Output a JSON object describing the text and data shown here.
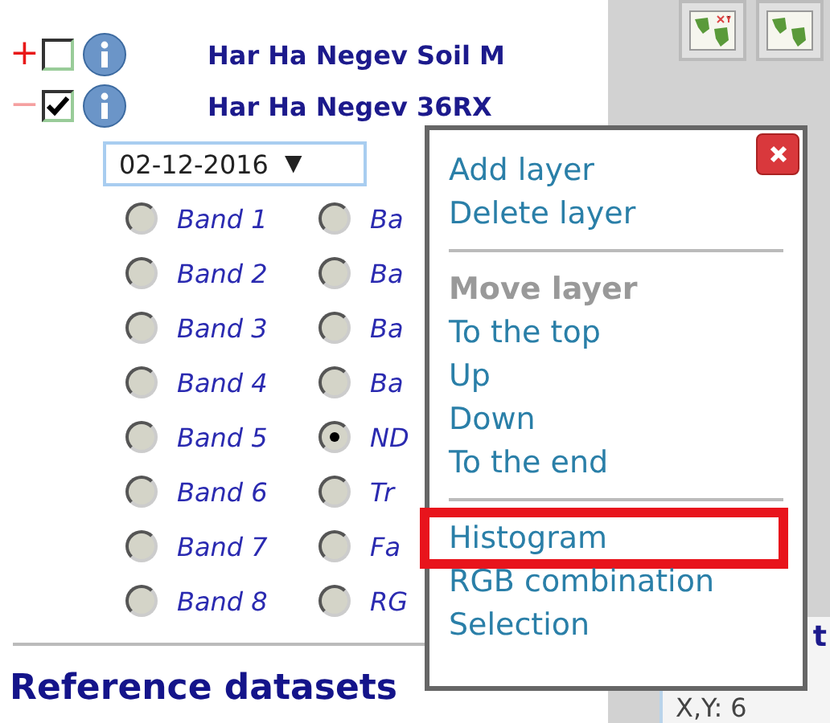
{
  "layers": [
    {
      "toggle": "+",
      "expanded": false,
      "checked": false,
      "title": "Har Ha Negev Soil M"
    },
    {
      "toggle": "−",
      "expanded": true,
      "checked": true,
      "title": "Har Ha Negev 36RX"
    }
  ],
  "date_select": {
    "value": "02-12-2016",
    "caret": "▼"
  },
  "band_options": [
    {
      "label": "Band 1",
      "selected": false
    },
    {
      "label": "Ba",
      "selected": false
    },
    {
      "label": "Band 2",
      "selected": false
    },
    {
      "label": "Ba",
      "selected": false
    },
    {
      "label": "Band 3",
      "selected": false
    },
    {
      "label": "Ba",
      "selected": false
    },
    {
      "label": "Band 4",
      "selected": false
    },
    {
      "label": "Ba",
      "selected": false
    },
    {
      "label": "Band 5",
      "selected": false
    },
    {
      "label": "ND",
      "selected": true
    },
    {
      "label": "Band 6",
      "selected": false
    },
    {
      "label": "Tr",
      "selected": false
    },
    {
      "label": "Band 7",
      "selected": false
    },
    {
      "label": "Fa",
      "selected": false
    },
    {
      "label": "Band 8",
      "selected": false
    },
    {
      "label": "RG",
      "selected": false
    }
  ],
  "section_heading": "Reference datasets",
  "context_menu": {
    "items": [
      {
        "kind": "item",
        "label": "Add layer",
        "highlighted": false
      },
      {
        "kind": "item",
        "label": "Delete layer",
        "highlighted": false
      },
      {
        "kind": "divider"
      },
      {
        "kind": "heading",
        "label": "Move layer"
      },
      {
        "kind": "item",
        "label": "To the top",
        "highlighted": false
      },
      {
        "kind": "item",
        "label": "Up",
        "highlighted": false
      },
      {
        "kind": "item",
        "label": "Down",
        "highlighted": false
      },
      {
        "kind": "item",
        "label": "To the end",
        "highlighted": false
      },
      {
        "kind": "divider"
      },
      {
        "kind": "item",
        "label": "Histogram",
        "highlighted": true
      },
      {
        "kind": "item",
        "label": "RGB combination",
        "highlighted": false
      },
      {
        "kind": "item",
        "label": "Selection",
        "highlighted": false
      }
    ]
  },
  "side_panel": {
    "link_fragment": "t",
    "coordinates": "X,Y: 6"
  }
}
